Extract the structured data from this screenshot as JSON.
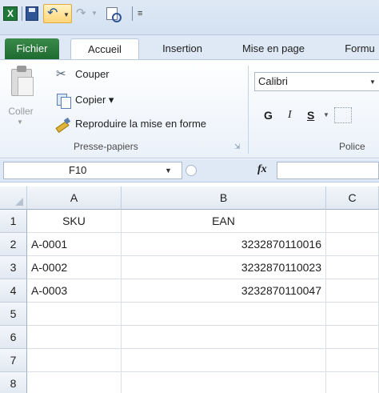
{
  "quick_access": {
    "app_icon": "excel-icon",
    "app_letter": "X",
    "save_icon": "save-icon",
    "undo_icon": "undo-icon",
    "redo_icon": "redo-icon",
    "print_preview_icon": "print-preview-icon",
    "customize_icon": "customize-icon"
  },
  "tabs": {
    "file": "Fichier",
    "home": "Accueil",
    "insert": "Insertion",
    "layout": "Mise en page",
    "formulas": "Formu"
  },
  "clipboard": {
    "paste": "Coller",
    "cut": "Couper",
    "copy": "Copier ▾",
    "format_painter": "Reproduire la mise en forme",
    "group": "Presse-papiers"
  },
  "font": {
    "name": "Calibri",
    "bold": "G",
    "italic": "I",
    "underline": "S",
    "group": "Police"
  },
  "formula_bar": {
    "name_box": "F10",
    "fx": "fx",
    "formula": ""
  },
  "sheet": {
    "columns": [
      "A",
      "B",
      "C"
    ],
    "rows": [
      {
        "num": "1",
        "a": "SKU",
        "b": "EAN",
        "c": ""
      },
      {
        "num": "2",
        "a": "A-0001",
        "b": "3232870110016",
        "c": ""
      },
      {
        "num": "3",
        "a": "A-0002",
        "b": "3232870110023",
        "c": ""
      },
      {
        "num": "4",
        "a": "A-0003",
        "b": "3232870110047",
        "c": ""
      },
      {
        "num": "5",
        "a": "",
        "b": "",
        "c": ""
      },
      {
        "num": "6",
        "a": "",
        "b": "",
        "c": ""
      },
      {
        "num": "7",
        "a": "",
        "b": "",
        "c": ""
      },
      {
        "num": "8",
        "a": "",
        "b": "",
        "c": ""
      }
    ]
  },
  "colors": {
    "file_tab": "#1e6b2f",
    "ribbon_bg": "#dfe9f5",
    "header_bg": "#e2e9f2"
  }
}
